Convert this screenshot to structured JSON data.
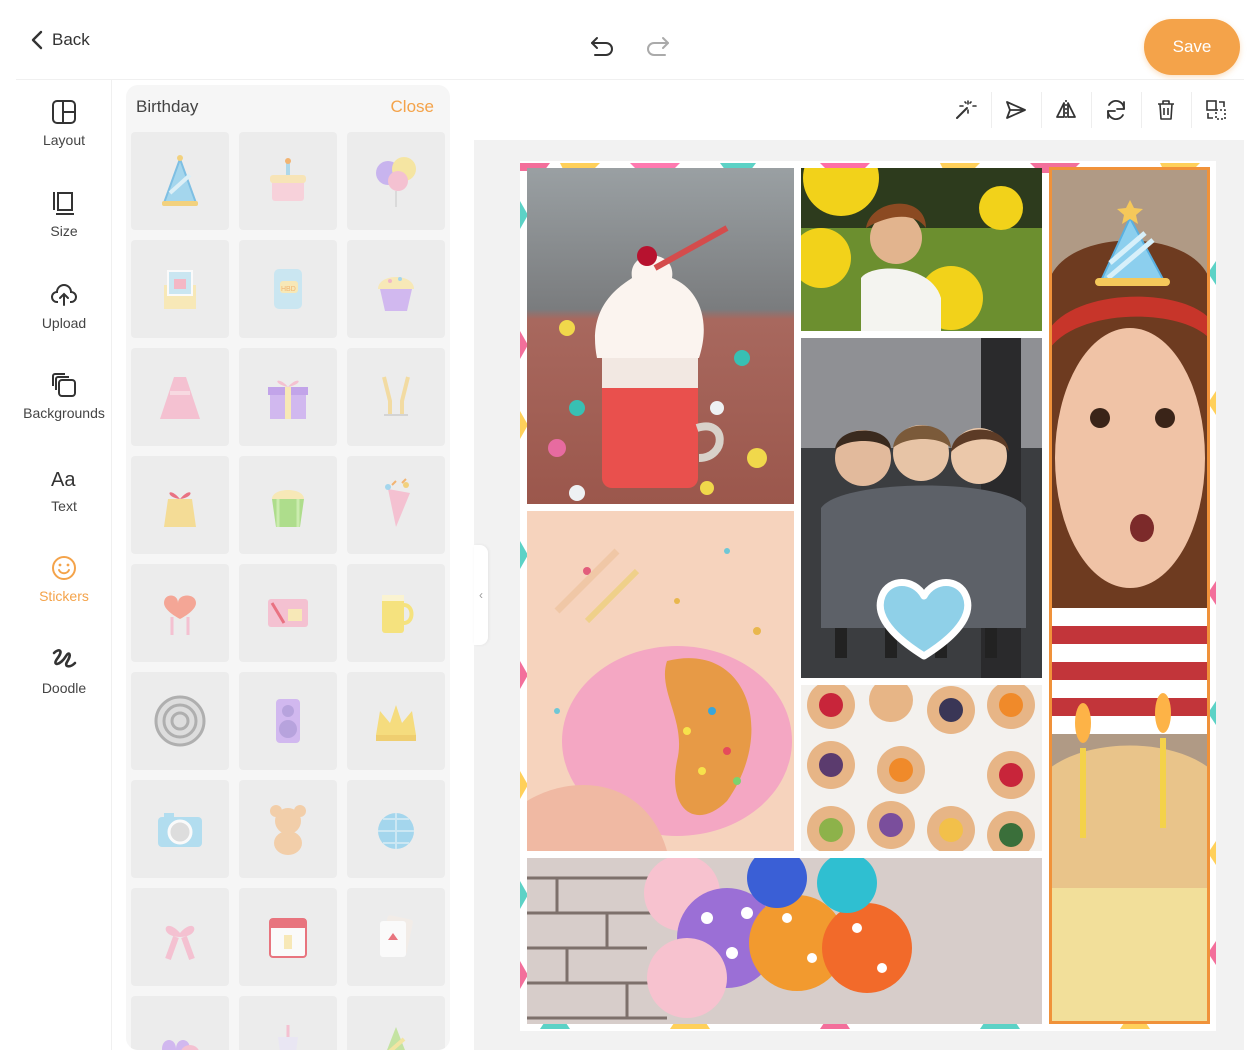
{
  "topbar": {
    "back_label": "Back",
    "save_label": "Save"
  },
  "rail": [
    {
      "key": "layout",
      "label": "Layout",
      "icon": "layout-icon"
    },
    {
      "key": "size",
      "label": "Size",
      "icon": "size-icon"
    },
    {
      "key": "upload",
      "label": "Upload",
      "icon": "upload-icon"
    },
    {
      "key": "backgrounds",
      "label": "Backgrounds",
      "icon": "backgrounds-icon"
    },
    {
      "key": "text",
      "label": "Text",
      "icon": "text-icon"
    },
    {
      "key": "stickers",
      "label": "Stickers",
      "icon": "stickers-icon",
      "active": true
    },
    {
      "key": "doodle",
      "label": "Doodle",
      "icon": "doodle-icon"
    }
  ],
  "panel": {
    "title": "Birthday",
    "close_label": "Close"
  },
  "stickers": [
    "party-hat",
    "birthday-cake",
    "balloons",
    "card-envelope",
    "hbd-phone",
    "cupcake",
    "pink-dress",
    "gift-box",
    "champagne-glasses",
    "bow-bag",
    "popcorn-bucket",
    "party-popper",
    "heart-lollipops",
    "gift-card",
    "beer-mug",
    "target",
    "speaker",
    "crown",
    "camera",
    "teddy-bear",
    "disco-ball",
    "ribbon-bow",
    "calendar",
    "playing-cards",
    "heart-candy",
    "drink-cup",
    "party-hat-green"
  ],
  "colors": {
    "accent": "#f4a34a",
    "selection": "#f0923a"
  },
  "toolbar": [
    "magic-wand-icon",
    "send-icon",
    "flip-icon",
    "rotate-icon",
    "trash-icon",
    "replace-icon"
  ],
  "collage": [
    "milkshake-photo",
    "toddler-balloons-photo",
    "kids-hug-photo",
    "donut-photo",
    "tarts-photo",
    "balloons-photo",
    "candle-blowing-photo"
  ]
}
